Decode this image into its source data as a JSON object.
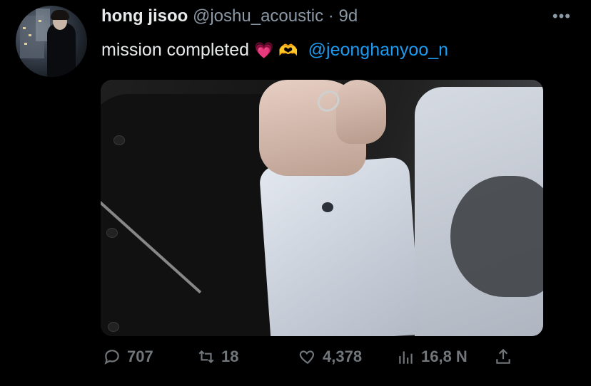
{
  "tweet": {
    "author_name": "hong jisoo",
    "handle": "@joshu_acoustic",
    "separator": "·",
    "time": "9d",
    "more_icon": "more-dots-icon",
    "text": "mission completed",
    "emoji_1": "💗",
    "emoji_2": "🫶",
    "mention": "@jeonghanyoo_n"
  },
  "stats": {
    "replies": "707",
    "retweets": "18",
    "likes": "4,378",
    "views": "16,8 N"
  },
  "colors": {
    "background": "#000000",
    "text": "#e7e9ea",
    "secondary": "#8b98a5",
    "link": "#1d9bf0"
  }
}
